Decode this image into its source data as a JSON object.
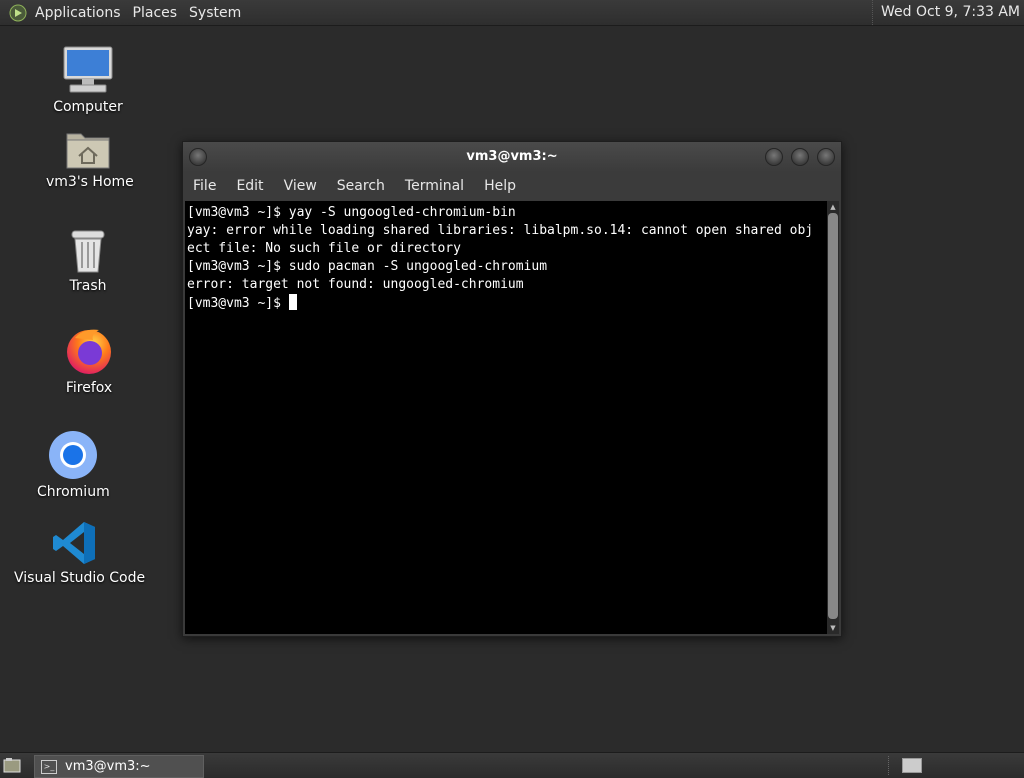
{
  "top_panel": {
    "menus": [
      "Applications",
      "Places",
      "System"
    ],
    "clock": "Wed Oct  9,  7:33 AM"
  },
  "desktop_icons": {
    "computer": "Computer",
    "home": "vm3's Home",
    "trash": "Trash",
    "firefox": "Firefox",
    "chromium": "Chromium",
    "vscode": "Visual Studio Code"
  },
  "terminal": {
    "title": "vm3@vm3:~",
    "menu": [
      "File",
      "Edit",
      "View",
      "Search",
      "Terminal",
      "Help"
    ],
    "lines": [
      "[vm3@vm3 ~]$ yay -S ungoogled-chromium-bin",
      "yay: error while loading shared libraries: libalpm.so.14: cannot open shared obj",
      "ect file: No such file or directory",
      "[vm3@vm3 ~]$ sudo pacman -S ungoogled-chromium",
      "error: target not found: ungoogled-chromium"
    ],
    "prompt": "[vm3@vm3 ~]$ "
  },
  "taskbar": {
    "task_label": "vm3@vm3:~"
  }
}
